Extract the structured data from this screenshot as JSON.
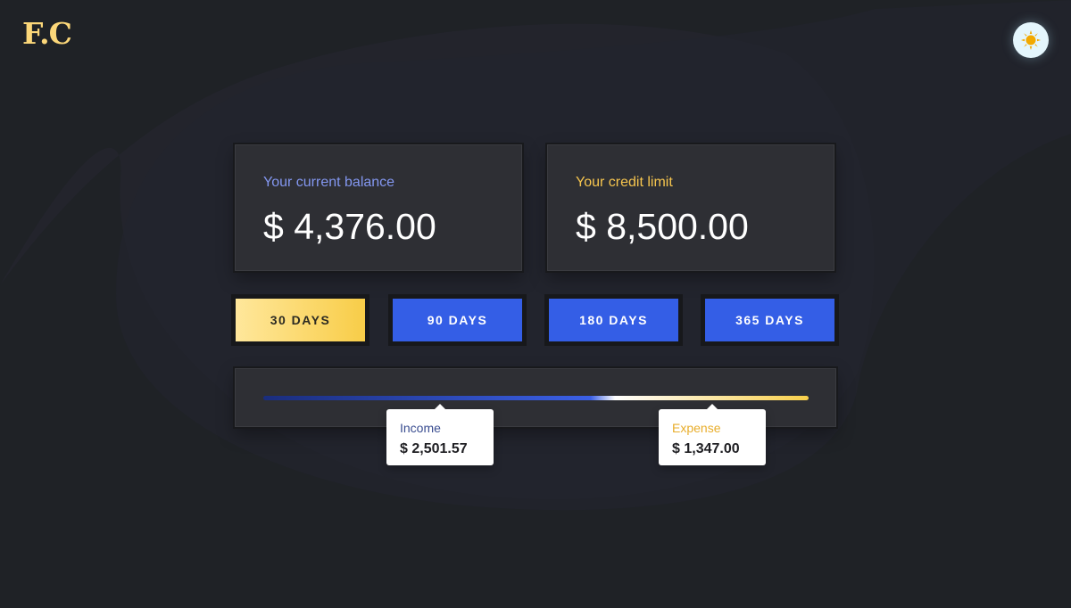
{
  "logo": {
    "text": "F.C"
  },
  "theme_toggle": {
    "icon": "sun-icon"
  },
  "balance_card": {
    "label": "Your current balance",
    "value": "$ 4,376.00"
  },
  "credit_card": {
    "label": "Your credit limit",
    "value": "$ 8,500.00"
  },
  "periods": [
    {
      "label": "30 DAYS",
      "active": true
    },
    {
      "label": "90 DAYS",
      "active": false
    },
    {
      "label": "180 DAYS",
      "active": false
    },
    {
      "label": "365 DAYS",
      "active": false
    }
  ],
  "summary": {
    "income": {
      "label": "Income",
      "value": "$ 2,501.57"
    },
    "expense": {
      "label": "Expense",
      "value": "$ 1,347.00"
    }
  },
  "colors": {
    "accent_blue": "#345ee6",
    "accent_yellow": "#f8cd48",
    "background": "#1f2226",
    "card": "#2e2f34"
  }
}
